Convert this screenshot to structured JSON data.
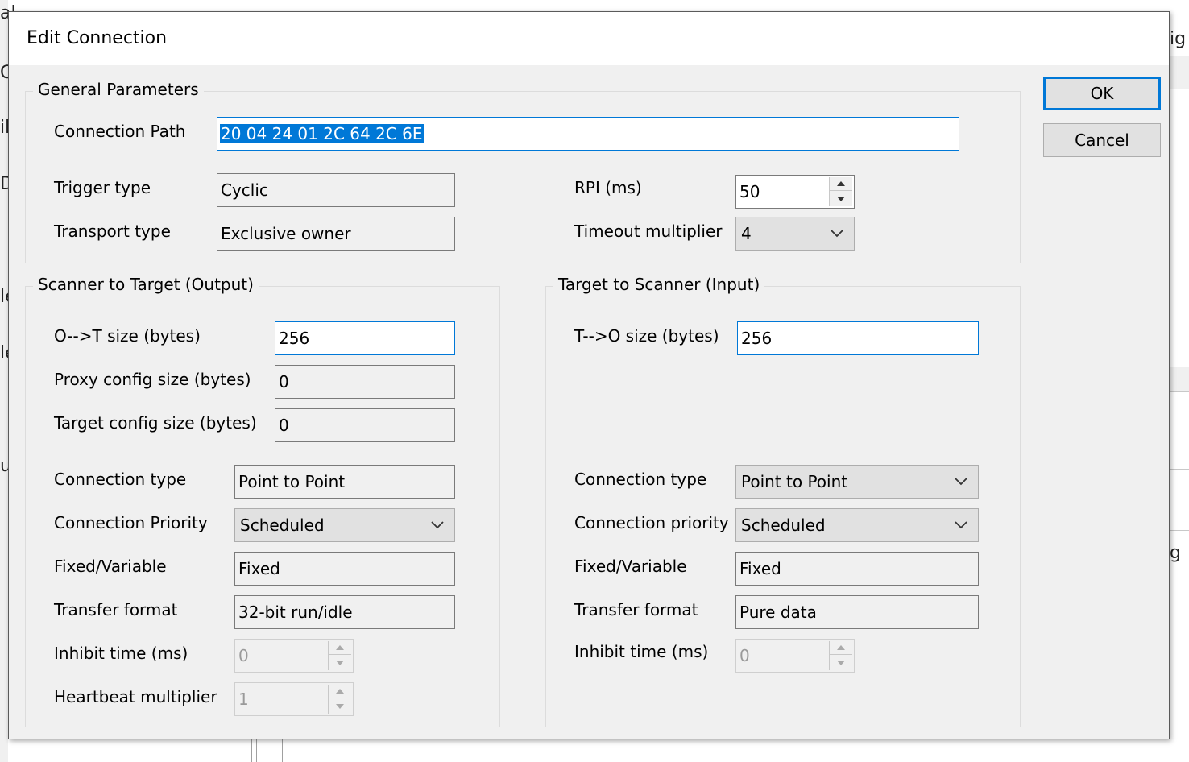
{
  "background": {
    "fragments": [
      "al",
      "C",
      "ib",
      "D",
      "le",
      "le",
      "ua",
      "ig",
      "g"
    ]
  },
  "dialog": {
    "title": "Edit Connection",
    "ok_label": "OK",
    "cancel_label": "Cancel"
  },
  "general": {
    "legend": "General Parameters",
    "connection_path_label": "Connection Path",
    "connection_path_value": "20 04 24 01 2C 64 2C 6E",
    "trigger_type_label": "Trigger type",
    "trigger_type_value": "Cyclic",
    "transport_type_label": "Transport type",
    "transport_type_value": "Exclusive owner",
    "rpi_label": "RPI (ms)",
    "rpi_value": "50",
    "timeout_label": "Timeout multiplier",
    "timeout_value": "4"
  },
  "output": {
    "legend": "Scanner to Target (Output)",
    "ot_size_label": "O-->T size (bytes)",
    "ot_size_value": "256",
    "proxy_label": "Proxy config size (bytes)",
    "proxy_value": "0",
    "target_config_label": "Target config size (bytes)",
    "target_config_value": "0",
    "conn_type_label": "Connection type",
    "conn_type_value": "Point to Point",
    "priority_label": "Connection Priority",
    "priority_value": "Scheduled",
    "fixed_label": "Fixed/Variable",
    "fixed_value": "Fixed",
    "transfer_label": "Transfer format",
    "transfer_value": "32-bit run/idle",
    "inhibit_label": "Inhibit time (ms)",
    "inhibit_value": "0",
    "heartbeat_label": "Heartbeat multiplier",
    "heartbeat_value": "1"
  },
  "input": {
    "legend": "Target to Scanner (Input)",
    "to_size_label": "T-->O size (bytes)",
    "to_size_value": "256",
    "conn_type_label": "Connection type",
    "conn_type_value": "Point to Point",
    "priority_label": "Connection priority",
    "priority_value": "Scheduled",
    "fixed_label": "Fixed/Variable",
    "fixed_value": "Fixed",
    "transfer_label": "Transfer format",
    "transfer_value": "Pure data",
    "inhibit_label": "Inhibit time (ms)",
    "inhibit_value": "0"
  },
  "colors": {
    "accent": "#0078d7",
    "dialog_bg": "#f0f0f0"
  },
  "icons": [
    "chevron-down-icon",
    "spin-up-icon",
    "spin-down-icon"
  ]
}
